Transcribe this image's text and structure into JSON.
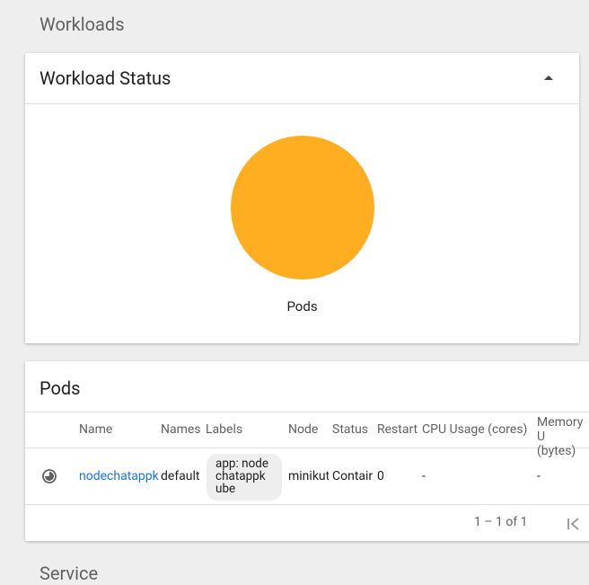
{
  "page": {
    "section_workloads": "Workloads",
    "section_service": "Service"
  },
  "workload_status": {
    "title": "Workload Status",
    "pie_color": "#ffae22",
    "pie_label": "Pods"
  },
  "pods": {
    "title": "Pods",
    "columns": [
      "Name",
      "Names",
      "Labels",
      "Node",
      "Status",
      "Restart",
      "CPU Usage (cores)",
      "Memory U\n(bytes)"
    ],
    "row": {
      "status_icon": "pending-clock-icon",
      "name": "nodechatappk",
      "namespace": "default",
      "labels": "app: node\nchatappk\nube",
      "node": "minikut",
      "status": "Contair",
      "restarts": "0",
      "cpu": "-",
      "memory": "-"
    },
    "pagination": "1 – 1 of 1"
  }
}
